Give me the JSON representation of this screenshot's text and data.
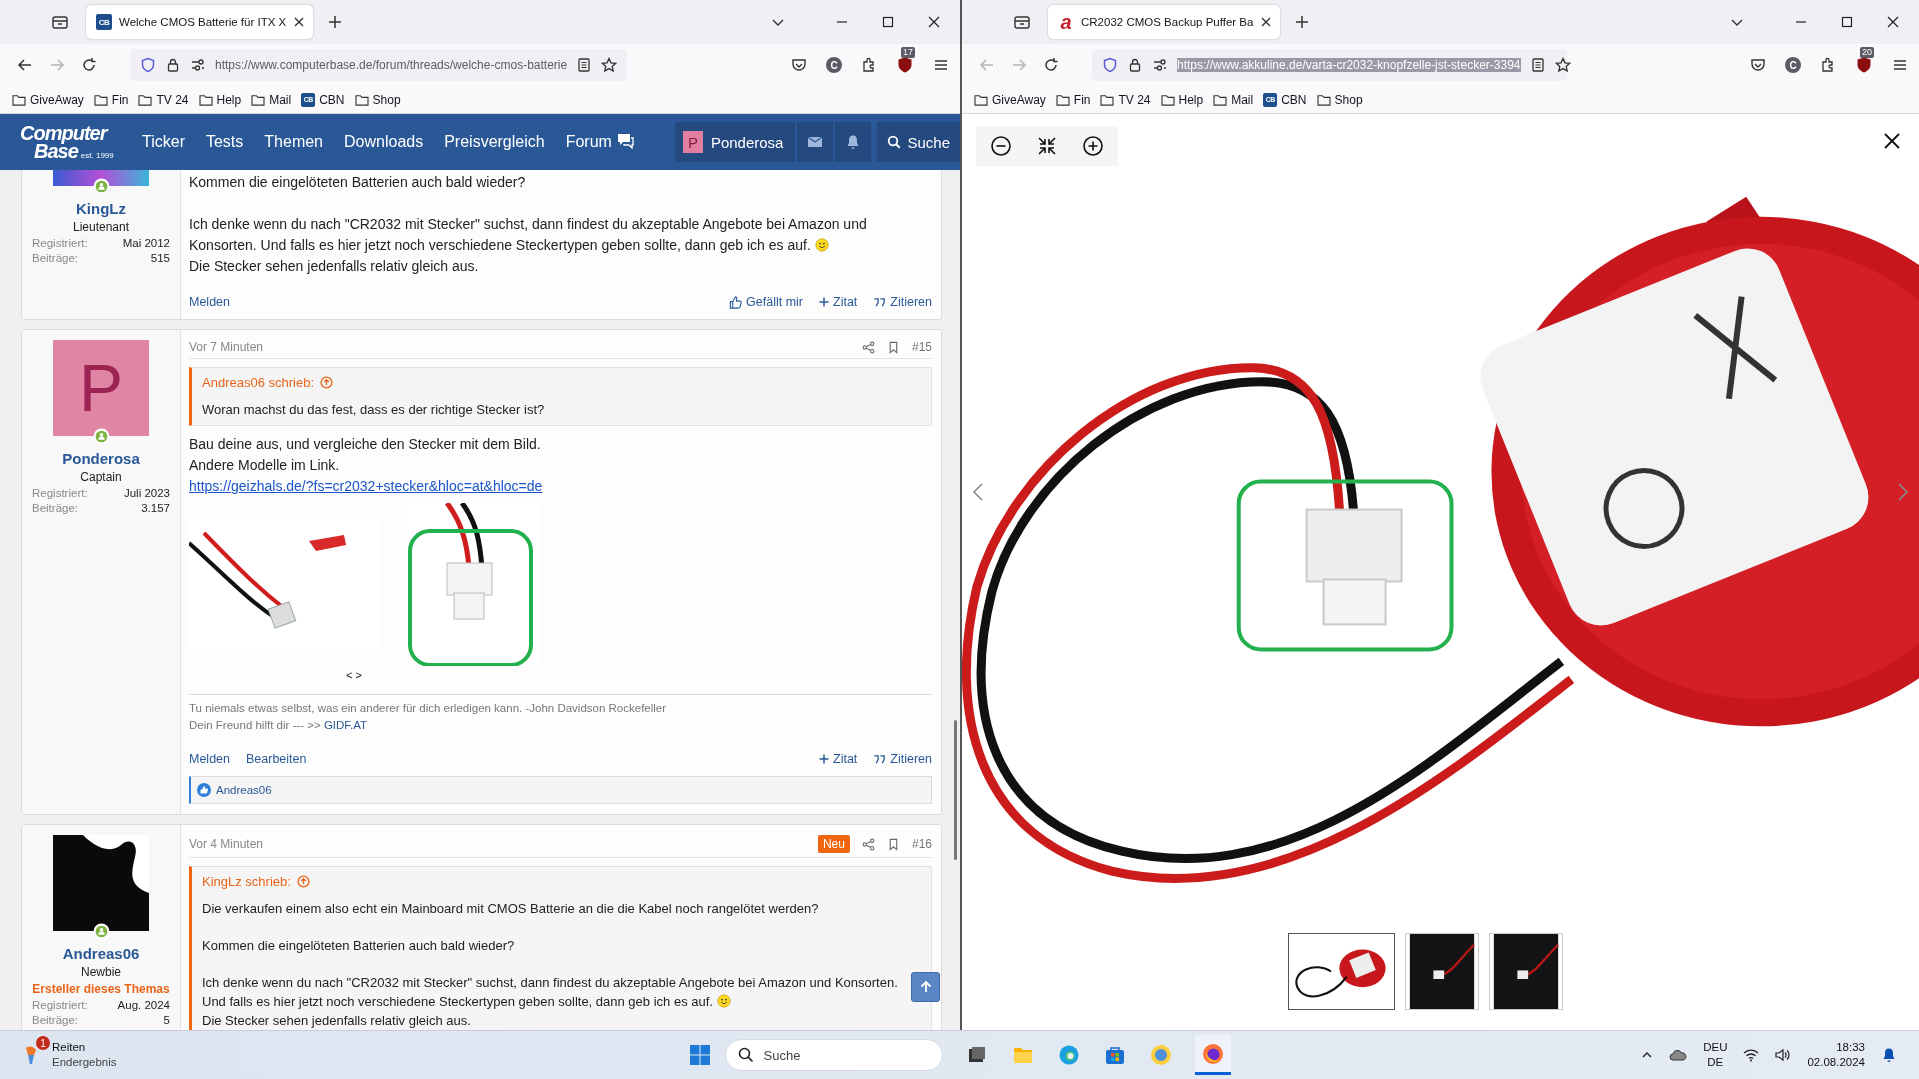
{
  "browsers": [
    {
      "tab": {
        "title": "Welche CMOS Batterie für ITX X",
        "icon": {
          "kind": "square",
          "text": "CB"
        }
      },
      "back_enabled": true,
      "forward_enabled": false,
      "url": "https://www.computerbase.de/forum/threads/welche-cmos-batterie",
      "url_selected": false,
      "account_letter": "C",
      "extension_badge": "17",
      "bookmarks": [
        {
          "label": "GiveAway",
          "kind": "folder"
        },
        {
          "label": "Fin",
          "kind": "folder"
        },
        {
          "label": "TV 24",
          "kind": "folder"
        },
        {
          "label": "Help",
          "kind": "folder"
        },
        {
          "label": "Mail",
          "kind": "folder"
        },
        {
          "label": "CBN",
          "kind": "site",
          "icon_text": "CB"
        },
        {
          "label": "Shop",
          "kind": "folder"
        }
      ]
    },
    {
      "tab": {
        "title": "CR2032 CMOS Backup Puffer Ba",
        "icon": {
          "kind": "letter",
          "text": "a"
        }
      },
      "back_enabled": false,
      "forward_enabled": false,
      "url": "https://www.akkuline.de/varta-cr2032-knopfzelle-jst-stecker-3394",
      "url_selected": true,
      "account_letter": "C",
      "extension_badge": "20",
      "bookmarks": [
        {
          "label": "GiveAway",
          "kind": "folder"
        },
        {
          "label": "Fin",
          "kind": "folder"
        },
        {
          "label": "TV 24",
          "kind": "folder"
        },
        {
          "label": "Help",
          "kind": "folder"
        },
        {
          "label": "Mail",
          "kind": "folder"
        },
        {
          "label": "CBN",
          "kind": "site",
          "icon_text": "CB"
        },
        {
          "label": "Shop",
          "kind": "folder"
        }
      ]
    }
  ],
  "forum": {
    "logo": {
      "line1": "Computer",
      "line2": "Base",
      "tagline": "est. 1999"
    },
    "nav": [
      {
        "label": "Ticker",
        "kind": "plain"
      },
      {
        "label": "Tests",
        "kind": "plain"
      },
      {
        "label": "Themen",
        "kind": "plain"
      },
      {
        "label": "Downloads",
        "kind": "plain"
      },
      {
        "label": "Preisvergleich",
        "kind": "plain"
      },
      {
        "label": "Forum",
        "kind": "with-icon"
      }
    ],
    "user": {
      "avatar_letter": "P",
      "name": "Ponderosa"
    },
    "search_label": "Suche",
    "posts": [
      {
        "author": {
          "name": "KingLz",
          "rank": "Lieutenant",
          "avatar": {
            "kind": "image-strip"
          },
          "online": true,
          "registered_label": "Registriert:",
          "registered": "Mai 2012",
          "posts_label": "Beiträge:",
          "posts": "515"
        },
        "paragraphs": [
          {
            "lines": [
              {
                "kind": "text",
                "text": "Kommen die eingelöteten Batterien auch bald wieder?",
                "smiley": false
              }
            ]
          },
          {
            "lines": [
              {
                "kind": "text",
                "text": "Ich denke wenn du nach \"CR2032 mit Stecker\" suchst, dann findest du akzeptable Angebote bei Amazon und",
                "smiley": false
              },
              {
                "kind": "text",
                "text": "Konsorten. Und falls es hier jetzt noch verschiedene Steckertypen geben sollte, dann geb ich es auf.",
                "smiley": true
              },
              {
                "kind": "text",
                "text": "Die Stecker sehen jedenfalls relativ gleich aus.",
                "smiley": false
              }
            ]
          }
        ],
        "actions_left": [
          "Melden"
        ],
        "actions_right": [
          {
            "kind": "like",
            "label": "Gefällt mir"
          },
          {
            "kind": "plus",
            "label": "Zitat"
          },
          {
            "kind": "quote",
            "label": "Zitieren"
          }
        ]
      },
      {
        "author": {
          "name": "Ponderosa",
          "rank": "Captain",
          "avatar": {
            "kind": "letter",
            "letter": "P"
          },
          "online": true,
          "registered_label": "Registriert:",
          "registered": "Juli 2023",
          "posts_label": "Beiträge:",
          "posts": "3.157"
        },
        "time": "Vor 7 Minuten",
        "is_new": false,
        "number": "#15",
        "quote": {
          "author": "Andreas06 schrieb:",
          "paragraphs": [
            {
              "lines": [
                {
                  "kind": "text",
                  "text": "Woran machst du das fest, dass es der richtige Stecker ist?",
                  "smiley": false
                }
              ]
            }
          ]
        },
        "paragraphs": [
          {
            "lines": [
              {
                "kind": "text",
                "text": "Bau deine aus, und vergleiche den Stecker mit dem Bild.",
                "smiley": false
              },
              {
                "kind": "text",
                "text": "Andere Modelle im Link.",
                "smiley": false
              },
              {
                "kind": "link",
                "text": "https://geizhals.de/?fs=cr2032+stecker&hloc=at&hloc=de"
              }
            ]
          }
        ],
        "attachments": {
          "images": [
            {
              "kind": "cable"
            },
            {
              "kind": "connector-highlight"
            }
          ],
          "nav": "< >"
        },
        "signature": {
          "text": "Tu niemals etwas selbst, was ein anderer für dich erledigen kann. -John Davidson Rockefeller",
          "link_prefix": "Dein Freund hilft dir --- >>",
          "link": "GIDF.AT"
        },
        "actions_left": [
          "Melden",
          "Bearbeiten"
        ],
        "actions_right": [
          {
            "kind": "plus",
            "label": "Zitat"
          },
          {
            "kind": "quote",
            "label": "Zitieren"
          }
        ],
        "reactions": {
          "names": "Andreas06"
        }
      },
      {
        "author": {
          "name": "Andreas06",
          "rank": "Newbie",
          "creator_label": "Ersteller dieses Themas",
          "avatar": {
            "kind": "image-dark"
          },
          "online": true,
          "registered_label": "Registriert:",
          "registered": "Aug. 2024",
          "posts_label": "Beiträge:",
          "posts": "5"
        },
        "time": "Vor 4 Minuten",
        "is_new": true,
        "new_label": "Neu",
        "number": "#16",
        "quote": {
          "author": "KingLz schrieb:",
          "paragraphs": [
            {
              "lines": [
                {
                  "kind": "text",
                  "text": "Die verkaufen einem also echt ein Mainboard mit CMOS Batterie an die die Kabel noch rangelötet werden?",
                  "smiley": false
                }
              ]
            },
            {
              "lines": [
                {
                  "kind": "text",
                  "text": "Kommen die eingelöteten Batterien auch bald wieder?",
                  "smiley": false
                }
              ]
            },
            {
              "lines": [
                {
                  "kind": "text",
                  "text": "Ich denke wenn du nach \"CR2032 mit Stecker\" suchst, dann findest du akzeptable Angebote bei Amazon und Konsorten.",
                  "smiley": false
                },
                {
                  "kind": "text",
                  "text": "Und falls es hier jetzt noch verschiedene Steckertypen geben sollte, dann geb ich es auf.",
                  "smiley": true
                },
                {
                  "kind": "text",
                  "text": "Die Stecker sehen jedenfalls relativ gleich aus.",
                  "smiley": false
                }
              ]
            }
          ]
        }
      }
    ]
  },
  "viewer": {
    "thumbnails": [
      {
        "kind": "battery",
        "selected": true
      },
      {
        "kind": "dark",
        "selected": false
      },
      {
        "kind": "dark",
        "selected": false
      }
    ]
  },
  "taskbar": {
    "widget": {
      "badge": "1",
      "title": "Reiten",
      "subtitle": "Endergebnis"
    },
    "search_placeholder": "Suche",
    "apps": [
      {
        "kind": "taskview",
        "active": false
      },
      {
        "kind": "explorer",
        "active": false
      },
      {
        "kind": "edge",
        "active": false
      },
      {
        "kind": "store",
        "active": false
      },
      {
        "kind": "app",
        "active": false
      },
      {
        "kind": "firefox",
        "active": true
      }
    ],
    "tray": {
      "language": "DEU",
      "layout": "DE",
      "time": "18:33",
      "date": "02.08.2024"
    }
  }
}
